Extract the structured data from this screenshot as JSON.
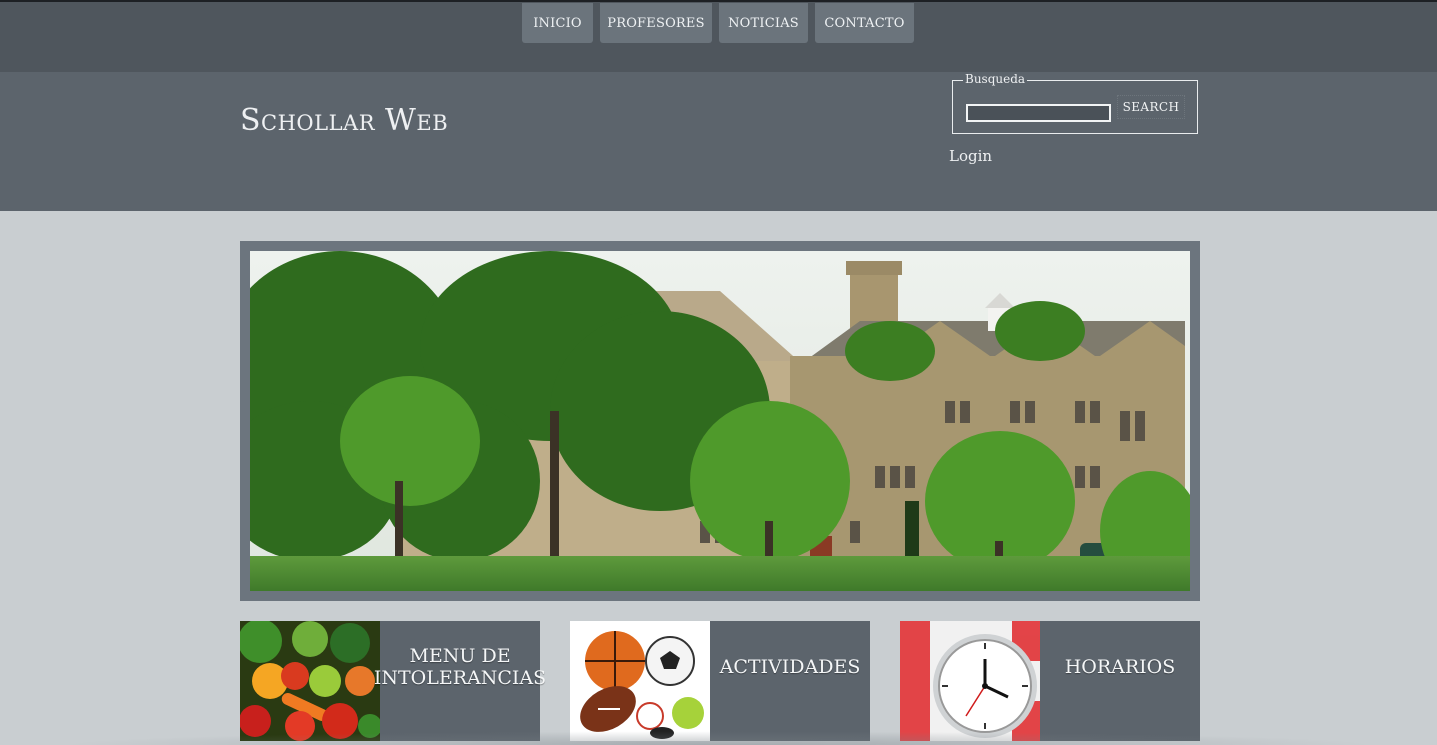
{
  "nav": {
    "items": [
      {
        "label": "INICIO"
      },
      {
        "label": "PROFESORES"
      },
      {
        "label": "NOTICIAS"
      },
      {
        "label": "CONTACTO"
      }
    ]
  },
  "header": {
    "brand": "Schollar Web",
    "search": {
      "legend": "Busqueda",
      "value": "",
      "placeholder": "",
      "button_label": "SEARCH"
    },
    "login_label": "Login"
  },
  "hero": {
    "image_icon": "school-building-photo"
  },
  "cards": [
    {
      "label": "MENU DE INTOLERANCIAS",
      "icon": "vegetables-photo"
    },
    {
      "label": "ACTIVIDADES",
      "icon": "sports-balls-photo"
    },
    {
      "label": "HORARIOS",
      "icon": "wall-clock-photo"
    }
  ],
  "colors": {
    "topnav_bg": "#4f565d",
    "nav_item_bg": "#6b747c",
    "header_bg": "#5c646c",
    "page_bg": "#c9ced1",
    "card_bg": "#5c646c"
  }
}
